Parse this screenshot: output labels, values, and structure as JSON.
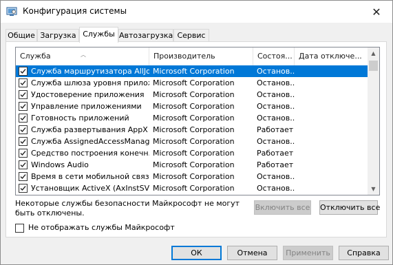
{
  "window": {
    "title": "Конфигурация системы",
    "close_glyph": "✕"
  },
  "tabs": [
    {
      "label": "Общие"
    },
    {
      "label": "Загрузка"
    },
    {
      "label": "Службы"
    },
    {
      "label": "Автозагрузка"
    },
    {
      "label": "Сервис"
    }
  ],
  "services": {
    "columns": [
      "Служба",
      "Производитель",
      "Состоя...",
      "Дата отключе..."
    ],
    "rows": [
      {
        "name": "Служба маршрутизатора AllJoyn",
        "vendor": "Microsoft Corporation",
        "status": "Останов...",
        "date": "",
        "checked": true
      },
      {
        "name": "Служба шлюза уровня прилож...",
        "vendor": "Microsoft Corporation",
        "status": "Останов...",
        "date": "",
        "checked": true
      },
      {
        "name": "Удостоверение приложения",
        "vendor": "Microsoft Corporation",
        "status": "Останов...",
        "date": "",
        "checked": true
      },
      {
        "name": "Управление приложениями",
        "vendor": "Microsoft Corporation",
        "status": "Останов...",
        "date": "",
        "checked": true
      },
      {
        "name": "Готовность приложений",
        "vendor": "Microsoft Corporation",
        "status": "Останов...",
        "date": "",
        "checked": true
      },
      {
        "name": "Служба развертывания AppX (...",
        "vendor": "Microsoft Corporation",
        "status": "Работает",
        "date": "",
        "checked": true
      },
      {
        "name": "Служба AssignedAccessManager",
        "vendor": "Microsoft Corporation",
        "status": "Останов...",
        "date": "",
        "checked": true
      },
      {
        "name": "Средство построения конечн...",
        "vendor": "Microsoft Corporation",
        "status": "Работает",
        "date": "",
        "checked": true
      },
      {
        "name": "Windows Audio",
        "vendor": "Microsoft Corporation",
        "status": "Работает",
        "date": "",
        "checked": true
      },
      {
        "name": "Время в сети мобильной связи",
        "vendor": "Microsoft Corporation",
        "status": "Останов...",
        "date": "",
        "checked": true
      },
      {
        "name": "Установщик ActiveX (AxInstSV)",
        "vendor": "Microsoft Corporation",
        "status": "Останов...",
        "date": "",
        "checked": true
      }
    ]
  },
  "note": "Некоторые службы безопасности Майкрософт не могут быть отключены.",
  "buttons": {
    "enable_all": "Включить все",
    "disable_all": "Отключить все",
    "ok": "ОК",
    "cancel": "Отмена",
    "apply": "Применить",
    "help": "Справка"
  },
  "hide_ms_label": "Не отображать службы Майкрософт",
  "colors": {
    "selection": "#0078d7",
    "window_bg": "#f0f0f0"
  }
}
